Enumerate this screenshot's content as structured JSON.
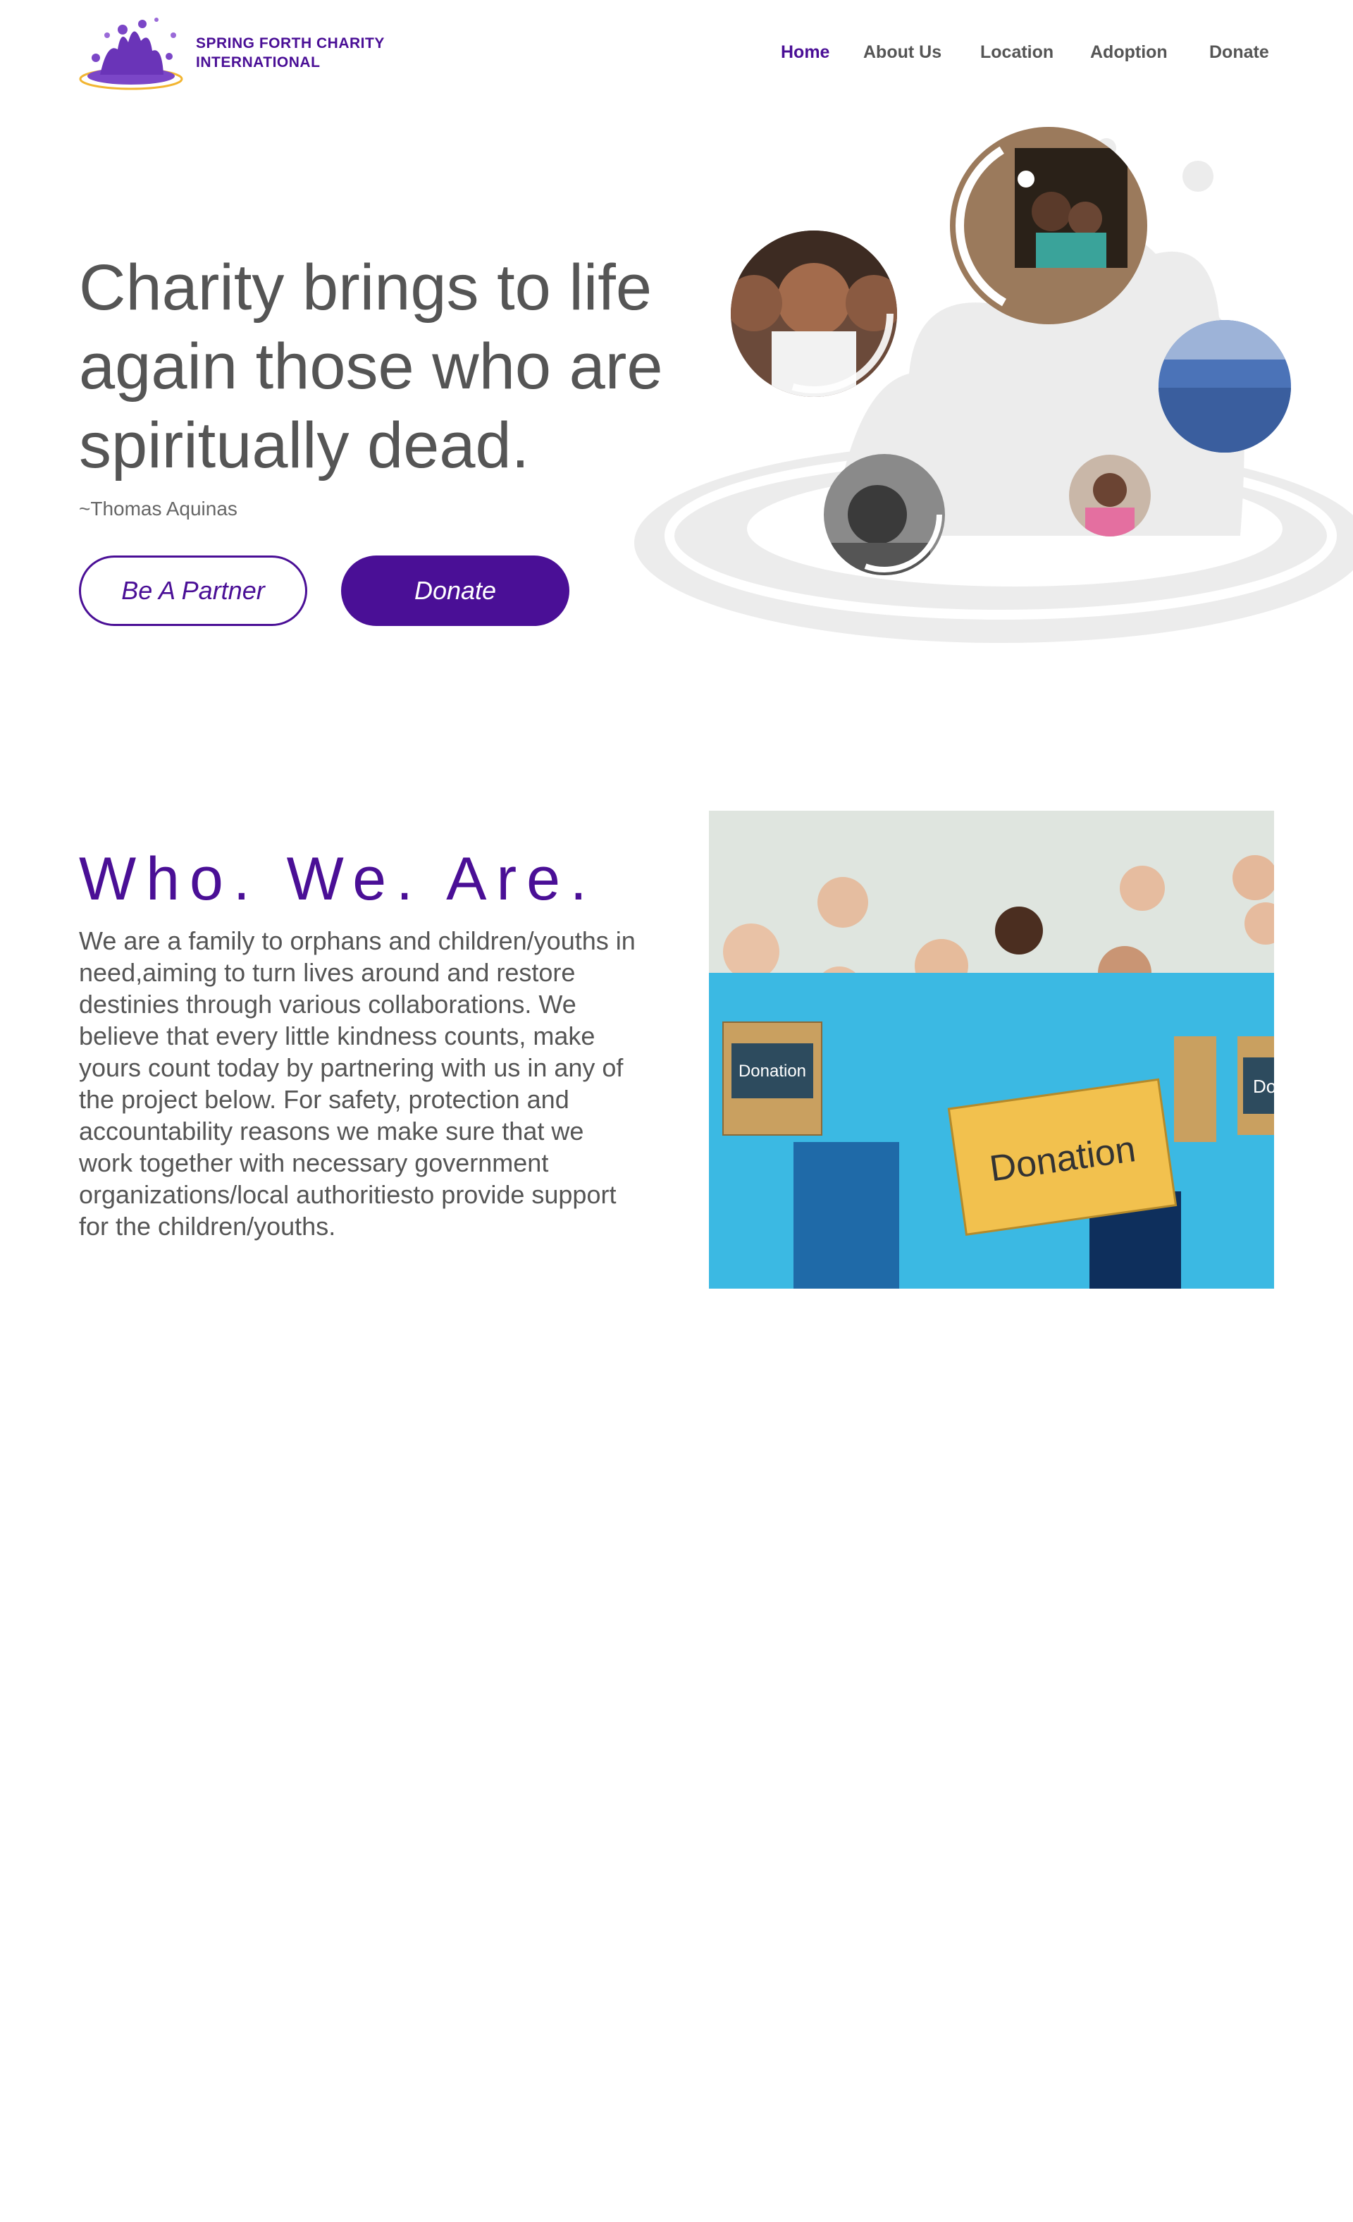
{
  "brand": {
    "name_line1": "SPRING FORTH CHARITY",
    "name_line2": "INTERNATIONAL"
  },
  "nav": {
    "items": [
      {
        "label": "Home",
        "active": true
      },
      {
        "label": "About Us",
        "active": false
      },
      {
        "label": "Location",
        "active": false
      },
      {
        "label": "Adoption",
        "active": false
      },
      {
        "label": "Donate",
        "active": false
      }
    ]
  },
  "hero": {
    "title": "Charity brings to life again those who are spiritually dead.",
    "quote": "~Thomas Aquinas",
    "partner_button": "Be A Partner",
    "donate_button": "Donate"
  },
  "who": {
    "title": "Who. We. Are.",
    "text": "We are a family to orphans and children/youths in need,aiming to turn lives around and restore destinies through various collaborations. We believe that every little kindness counts, make yours count today by partnering with us in any of the project below. For safety, protection and accountability reasons we make sure that we work together with necessary government organizations/local authoritiesto provide support for the children/youths.",
    "photo_box_left": "Donation",
    "photo_box_center": "Donation",
    "photo_box_right": "Do"
  },
  "colors": {
    "primary": "#4a0f96",
    "text": "#555555",
    "shirt": "#3bb9e3"
  },
  "icons": [
    "logo-splash-icon"
  ]
}
